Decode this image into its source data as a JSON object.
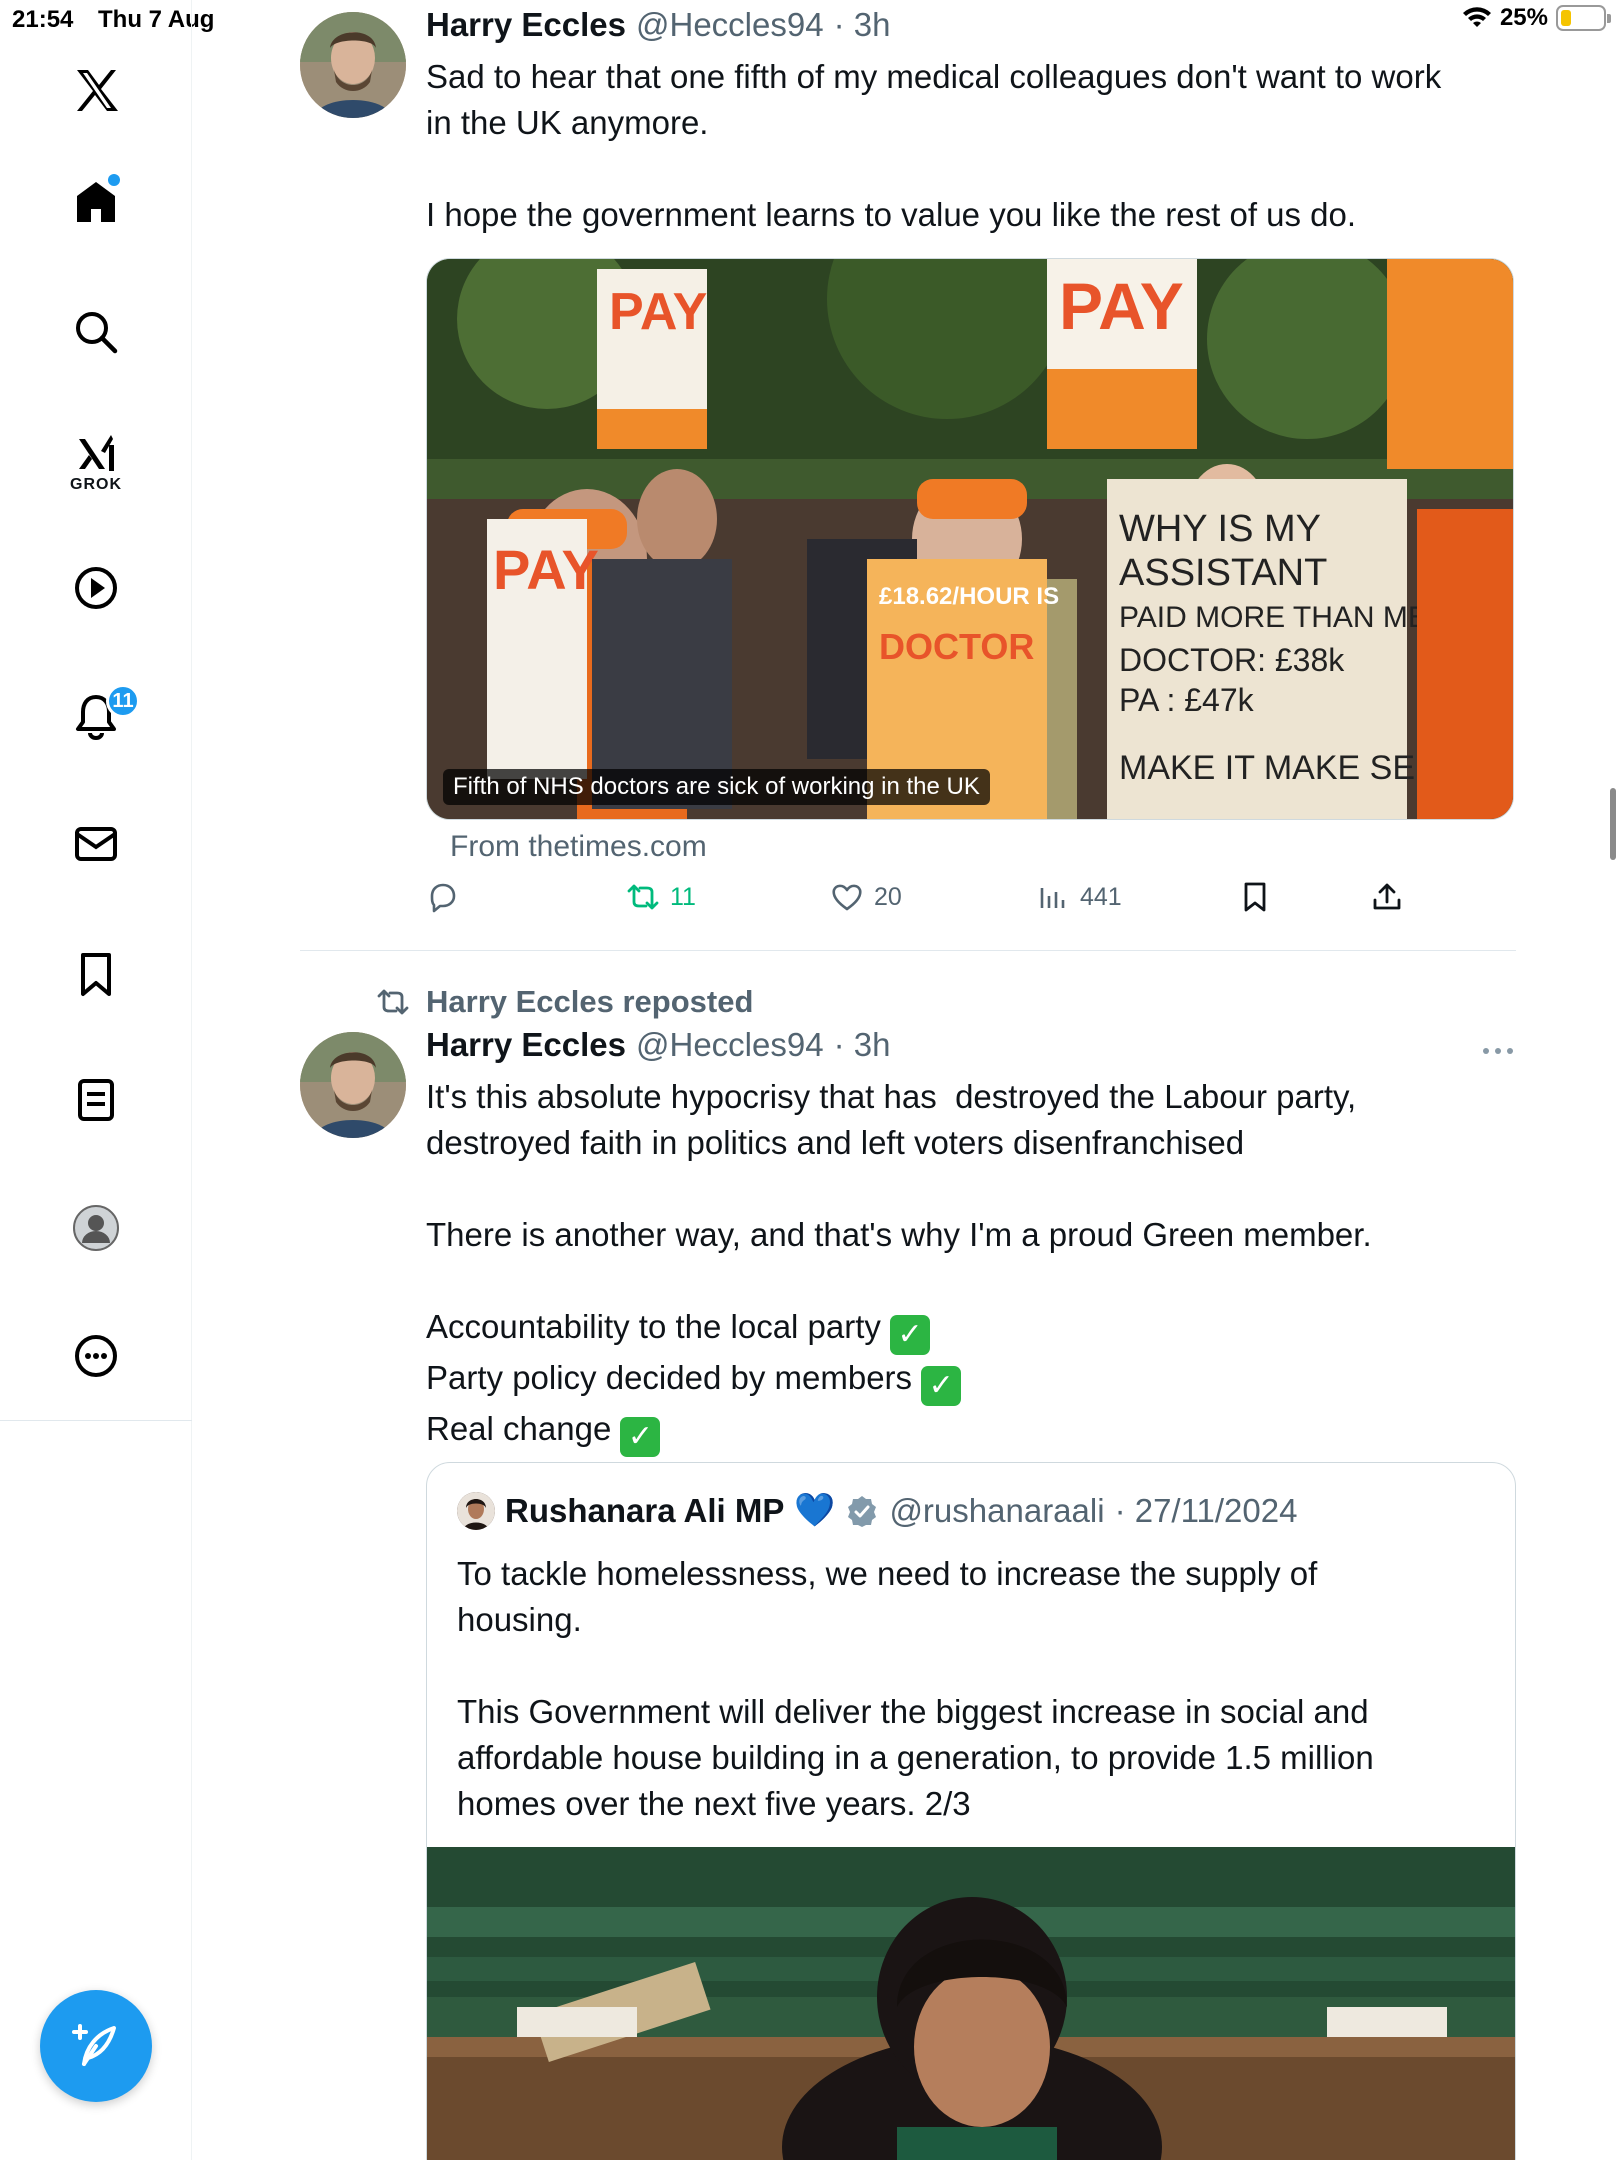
{
  "status": {
    "time": "21:54",
    "date": "Thu 7 Aug",
    "battery": "25%",
    "battery_level": 0.25
  },
  "sidebar": {
    "items": [
      {
        "name": "home",
        "icon": "home-icon"
      },
      {
        "name": "explore",
        "icon": "search-icon"
      },
      {
        "name": "grok",
        "icon": "grok-icon",
        "label": "GROK"
      },
      {
        "name": "video",
        "icon": "play-icon"
      },
      {
        "name": "notifications",
        "icon": "bell-icon",
        "badge": "11"
      },
      {
        "name": "messages",
        "icon": "mail-icon"
      },
      {
        "name": "bookmarks",
        "icon": "bookmark-icon"
      },
      {
        "name": "lists",
        "icon": "list-icon"
      },
      {
        "name": "profile",
        "icon": "profile-icon"
      },
      {
        "name": "more",
        "icon": "more-circle-icon"
      }
    ],
    "compose_icon": "compose-icon"
  },
  "tweet1": {
    "name": "Harry Eccles",
    "handle": "@Heccles94",
    "time": "· 3h",
    "text": "Sad to hear that one fifth of my medical colleagues don't want to work\nin the UK anymore.\n\nI hope the government learns to value you like the rest of us do.",
    "card_caption": "Fifth of NHS doctors are sick of working in the UK",
    "card_source": "From thetimes.com",
    "retweets": "11",
    "likes": "20",
    "views": "441",
    "retweet_color": "#00ba7c"
  },
  "tweet2": {
    "repost_label": "Harry Eccles reposted",
    "name": "Harry Eccles",
    "handle": "@Heccles94",
    "time": "· 3h",
    "text": "It's this absolute hypocrisy that has  destroyed the Labour party,\ndestroyed faith in politics and left voters disenfranchised\n\nThere is another way, and that's why I'm a proud Green member.",
    "checklist": [
      "Accountability to the local party",
      "Party policy decided by members",
      "Real change"
    ],
    "quote": {
      "name": "Rushanara Ali MP",
      "name_emoji": "💙",
      "handle": "@rushanaraali",
      "date": "· 27/11/2024",
      "text": "To tackle homelessness, we need to increase the supply of\nhousing.\n\nThis Government will deliver the biggest increase in social and\naffordable house building in a generation, to provide 1.5 million\nhomes over the next five years. 2/3"
    }
  },
  "colors": {
    "accent": "#1d9bf0",
    "muted": "#536471",
    "check_green": "#2cb543"
  }
}
